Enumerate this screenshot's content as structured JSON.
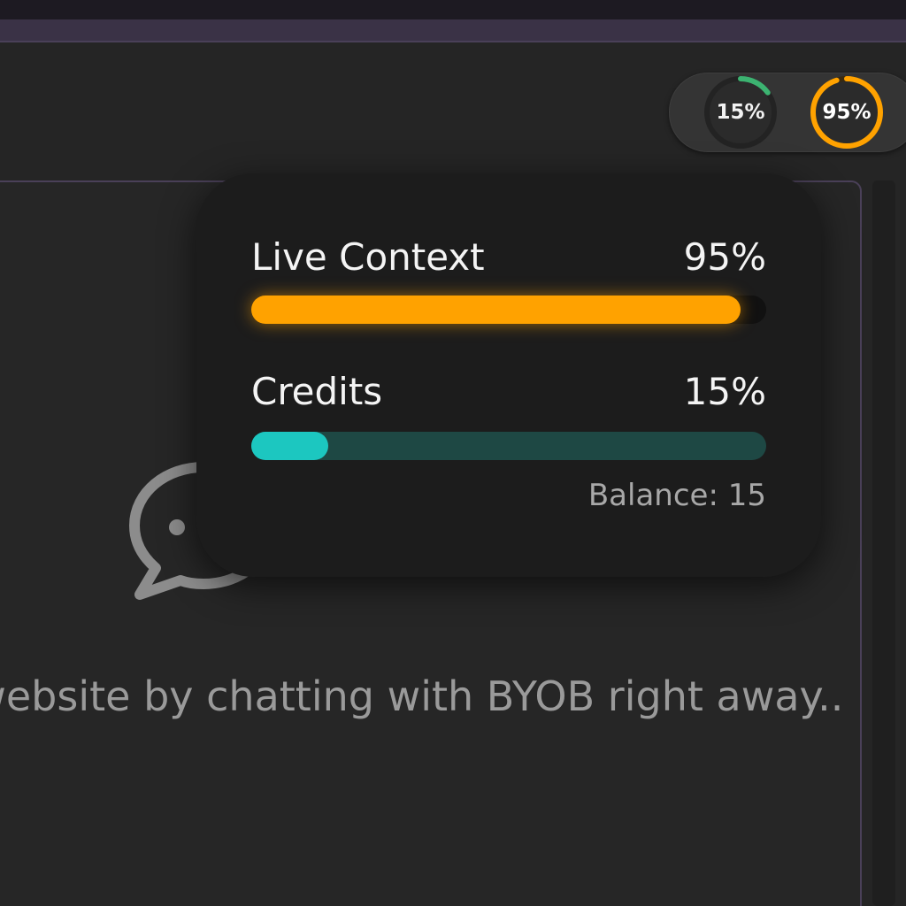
{
  "usage": {
    "credits_badge": "15%",
    "credits_fraction": 0.15,
    "context_badge": "95%",
    "context_fraction": 0.95,
    "credits_color": "#3cb371",
    "context_color": "#ffa200"
  },
  "popover": {
    "context": {
      "label": "Live Context",
      "percent": "95%",
      "fraction": 0.95,
      "color": "#ffa200"
    },
    "credits": {
      "label": "Credits",
      "percent": "15%",
      "fraction": 0.15,
      "color": "#1cc7c0"
    },
    "balance": "Balance: 15"
  },
  "empty_state": {
    "icon": "chat-bubble-icon",
    "message": "ur website by chatting with BYOB right away.."
  }
}
